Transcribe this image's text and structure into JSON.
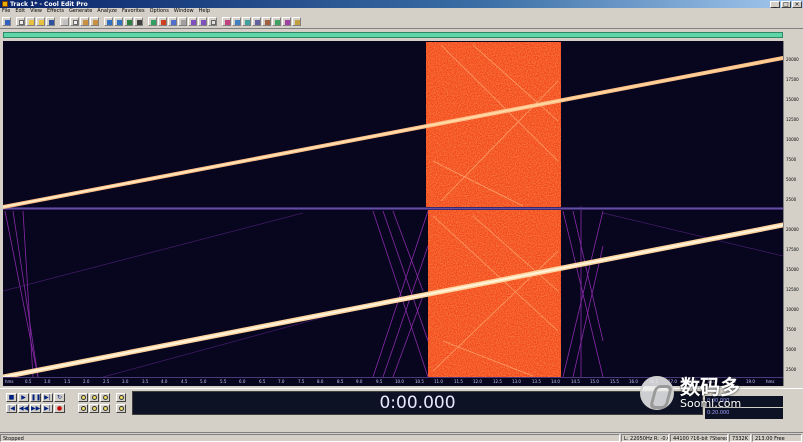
{
  "window": {
    "title": "Track 1* - Cool Edit Pro",
    "minimize": "_",
    "maximize": "□",
    "close": "×"
  },
  "menu": [
    "File",
    "Edit",
    "View",
    "Effects",
    "Generate",
    "Analyze",
    "Favorites",
    "Options",
    "Window",
    "Help"
  ],
  "frequency_ruler": {
    "top_labels": [
      "20000",
      "17500",
      "15000",
      "12500",
      "10000",
      "7500",
      "5000",
      "2500"
    ],
    "bottom_labels": [
      "20000",
      "17500",
      "15000",
      "12500",
      "10000",
      "7500",
      "5000",
      "2500"
    ]
  },
  "time_ruler": [
    "hms",
    "0.5",
    "1.0",
    "1.5",
    "2.0",
    "2.5",
    "3.0",
    "3.5",
    "4.0",
    "4.5",
    "5.0",
    "5.5",
    "6.0",
    "6.5",
    "7.0",
    "7.5",
    "8.0",
    "8.5",
    "9.0",
    "9.5",
    "10.0",
    "10.5",
    "11.0",
    "11.5",
    "12.0",
    "12.5",
    "13.0",
    "13.5",
    "14.0",
    "14.5",
    "15.0",
    "15.5",
    "16.0",
    "16.5",
    "17.0",
    "17.5",
    "18.0",
    "18.5",
    "19.0",
    "hms"
  ],
  "transport": {
    "time": "0:00.000",
    "readout_top": "0:00.000",
    "readout_bottom": "0:20.000"
  },
  "watermark": {
    "cn": "数码多",
    "en": "Sooml.com"
  },
  "status": {
    "state": "Stopped",
    "position": "L: 22050Hz R: -0.0 .279",
    "format": "44100 ?16-bit ?Stereo",
    "size": "7332K",
    "free": "213.00 Free"
  },
  "colors": {
    "background": "#07061e",
    "band": "#ff4a1a",
    "sweep": "#ffe2b0",
    "overview": "#5fd6a8"
  }
}
